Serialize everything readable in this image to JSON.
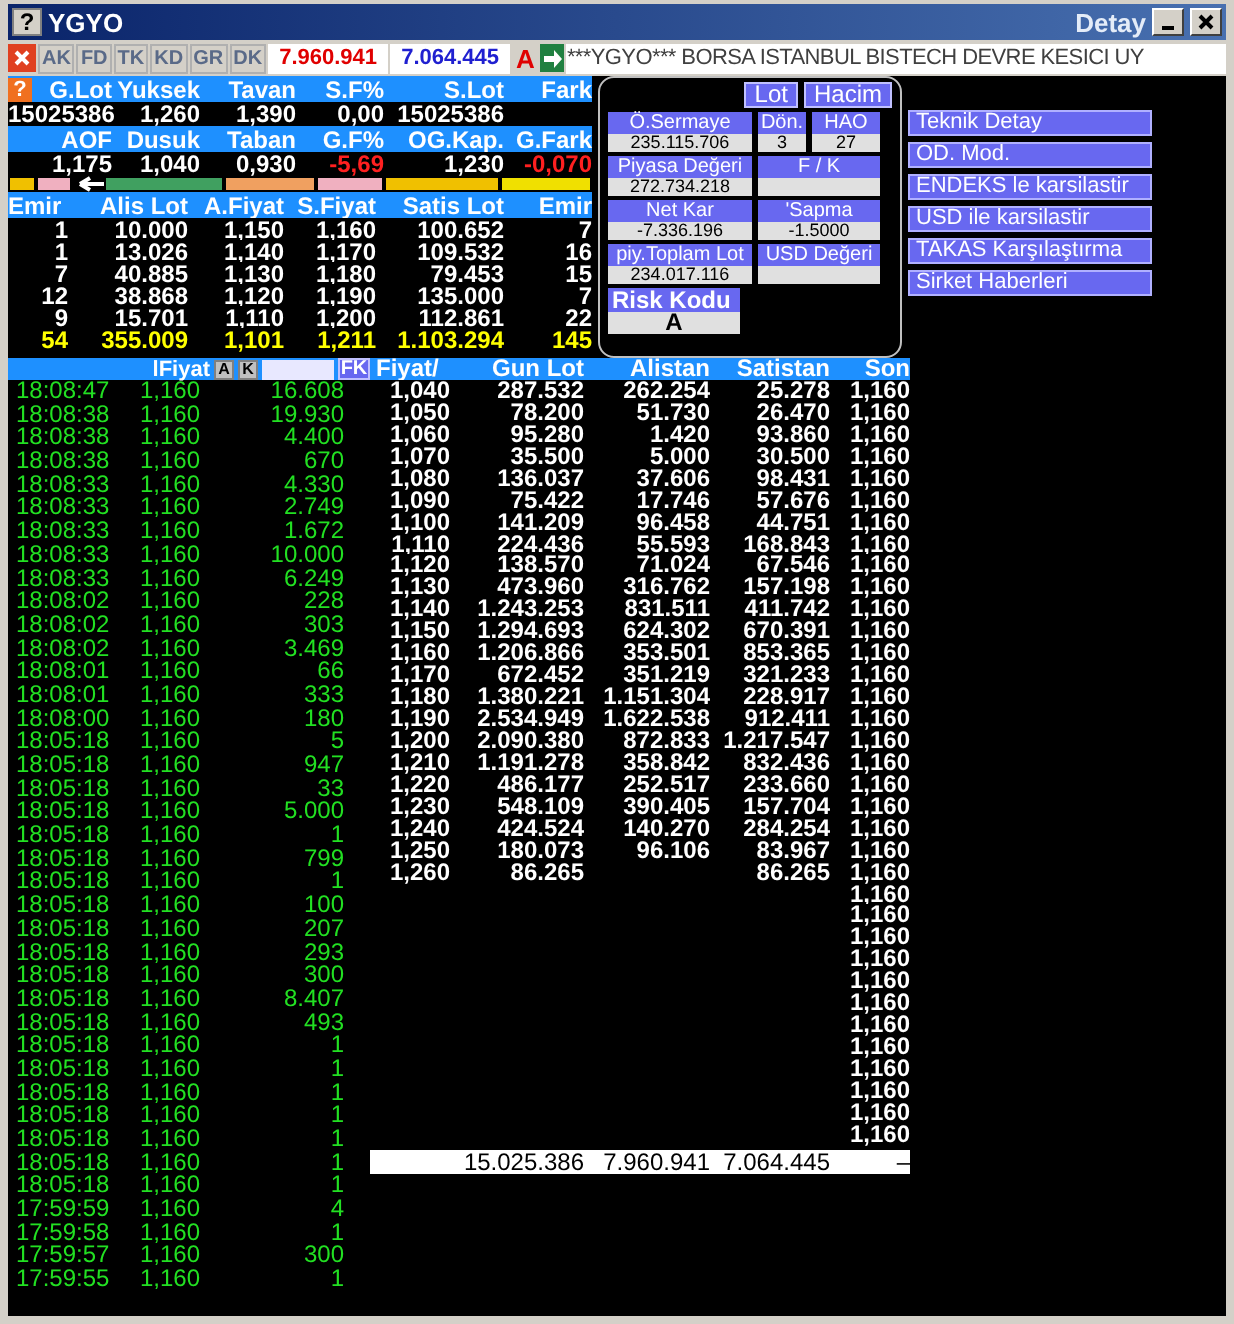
{
  "window": {
    "help": "?",
    "title": "YGYO",
    "detail_label": "Detay"
  },
  "toolbar": {
    "tabs": [
      "AK",
      "FD",
      "TK",
      "KD",
      "GR",
      "DK"
    ],
    "value_red": "7.960.941",
    "value_blue": "7.064.445",
    "letter": "A",
    "ticker": "***YGYO*** BORSA ISTANBUL BISTECH DEVRE KESICI UY"
  },
  "stats": {
    "help": "?",
    "rows": [
      {
        "headers": [
          "G.Lot",
          "Yuksek",
          "Tavan",
          "S.F%",
          "S.Lot",
          "Fark"
        ],
        "values": [
          {
            "text": "15025386",
            "negative": false
          },
          {
            "text": "1,260",
            "negative": false
          },
          {
            "text": "1,390",
            "negative": false
          },
          {
            "text": "0,00",
            "negative": false
          },
          {
            "text": "15025386",
            "negative": false
          }
        ]
      },
      {
        "headers": [
          "AOF",
          "Dusuk",
          "Taban",
          "G.F%",
          "OG.Kap.",
          "G.Fark"
        ],
        "values": [
          {
            "text": "1,175",
            "negative": false
          },
          {
            "text": "1,040",
            "negative": false
          },
          {
            "text": "0,930",
            "negative": false
          },
          {
            "text": "-5,69",
            "negative": true
          },
          {
            "text": "1,230",
            "negative": false
          },
          {
            "text": "-0,070",
            "negative": true
          }
        ]
      }
    ]
  },
  "order_book": {
    "columns": [
      "Emir",
      "Alis Lot",
      "A.Fiyat",
      "S.Fiyat",
      "Satis Lot",
      "Emir"
    ],
    "rows": [
      [
        "1",
        "10.000",
        "1,150",
        "1,160",
        "100.652",
        "7"
      ],
      [
        "1",
        "13.026",
        "1,140",
        "1,170",
        "109.532",
        "16"
      ],
      [
        "7",
        "40.885",
        "1,130",
        "1,180",
        "79.453",
        "15"
      ],
      [
        "12",
        "38.868",
        "1,120",
        "1,190",
        "135.000",
        "7"
      ],
      [
        "9",
        "15.701",
        "1,110",
        "1,200",
        "112.861",
        "22"
      ]
    ],
    "totals": [
      "54",
      "355.009",
      "1,101",
      "1,211",
      "1.103.294",
      "145"
    ]
  },
  "panel": {
    "toggles": [
      "Lot",
      "Hacim"
    ],
    "rows": [
      [
        {
          "label": "Ö.Sermaye",
          "value": "235.115.706"
        },
        {
          "label": "Dön.",
          "value": "3"
        },
        {
          "label": "HAO",
          "value": "27"
        }
      ],
      [
        {
          "label": "Piyasa Değeri",
          "value": "272.734.218"
        },
        {
          "label": "F / K"
        }
      ],
      [
        {
          "label": "Net Kar",
          "value": "-7.336.196"
        },
        {
          "label": "'Sapma",
          "value": "-1.5000"
        }
      ],
      [
        {
          "label": "piy.Toplam Lot",
          "value": "234.017.116"
        },
        {
          "label": "USD Değeri"
        }
      ]
    ],
    "risk": {
      "label": "Risk Kodu",
      "value": "A"
    }
  },
  "actions": [
    "Teknik Detay",
    "OD. Mod.",
    "ENDEKS le karsilastir",
    "USD ile karsilastir",
    "TAKAS Karşılaştırma",
    "Sirket Haberleri"
  ],
  "trades": {
    "header": "lFiyat",
    "buttons": [
      "A",
      "K"
    ],
    "filter_button": "FK",
    "rows": [
      [
        "18:08:47",
        "1,160",
        "16.608"
      ],
      [
        "18:08:38",
        "1,160",
        "19.930"
      ],
      [
        "18:08:38",
        "1,160",
        "4.400"
      ],
      [
        "18:08:38",
        "1,160",
        "670"
      ],
      [
        "18:08:33",
        "1,160",
        "4.330"
      ],
      [
        "18:08:33",
        "1,160",
        "2.749"
      ],
      [
        "18:08:33",
        "1,160",
        "1.672"
      ],
      [
        "18:08:33",
        "1,160",
        "10.000"
      ],
      [
        "18:08:33",
        "1,160",
        "6.249"
      ],
      [
        "18:08:02",
        "1,160",
        "228"
      ],
      [
        "18:08:02",
        "1,160",
        "303"
      ],
      [
        "18:08:02",
        "1,160",
        "3.469"
      ],
      [
        "18:08:01",
        "1,160",
        "66"
      ],
      [
        "18:08:01",
        "1,160",
        "333"
      ],
      [
        "18:08:00",
        "1,160",
        "180"
      ],
      [
        "18:05:18",
        "1,160",
        "5"
      ],
      [
        "18:05:18",
        "1,160",
        "947"
      ],
      [
        "18:05:18",
        "1,160",
        "33"
      ],
      [
        "18:05:18",
        "1,160",
        "5.000"
      ],
      [
        "18:05:18",
        "1,160",
        "1"
      ],
      [
        "18:05:18",
        "1,160",
        "799"
      ],
      [
        "18:05:18",
        "1,160",
        "1"
      ],
      [
        "18:05:18",
        "1,160",
        "100"
      ],
      [
        "18:05:18",
        "1,160",
        "207"
      ],
      [
        "18:05:18",
        "1,160",
        "293"
      ],
      [
        "18:05:18",
        "1,160",
        "300"
      ],
      [
        "18:05:18",
        "1,160",
        "8.407"
      ],
      [
        "18:05:18",
        "1,160",
        "493"
      ],
      [
        "18:05:18",
        "1,160",
        "1"
      ],
      [
        "18:05:18",
        "1,160",
        "1"
      ],
      [
        "18:05:18",
        "1,160",
        "1"
      ],
      [
        "18:05:18",
        "1,160",
        "1"
      ],
      [
        "18:05:18",
        "1,160",
        "1"
      ],
      [
        "18:05:18",
        "1,160",
        "1"
      ],
      [
        "18:05:18",
        "1,160",
        "1"
      ],
      [
        "17:59:59",
        "1,160",
        "4"
      ],
      [
        "17:59:58",
        "1,160",
        "1"
      ],
      [
        "17:59:57",
        "1,160",
        "300"
      ],
      [
        "17:59:55",
        "1,160",
        "1"
      ]
    ]
  },
  "price_table": {
    "columns": [
      "Fiyat/",
      "Gun Lot",
      "Alistan",
      "Satistan",
      "Son"
    ],
    "rows": [
      {
        "price": "1,040",
        "gun_lot": "287.532",
        "alistan": "262.254",
        "satistan": "25.278",
        "son": "1,160"
      },
      {
        "price": "1,050",
        "gun_lot": "78.200",
        "alistan": "51.730",
        "satistan": "26.470",
        "son": "1,160"
      },
      {
        "price": "1,060",
        "gun_lot": "95.280",
        "alistan": "1.420",
        "satistan": "93.860",
        "son": "1,160"
      },
      {
        "price": "1,070",
        "gun_lot": "35.500",
        "alistan": "5.000",
        "satistan": "30.500",
        "son": "1,160"
      },
      {
        "price": "1,080",
        "gun_lot": "136.037",
        "alistan": "37.606",
        "satistan": "98.431",
        "son": "1,160"
      },
      {
        "price": "1,090",
        "gun_lot": "75.422",
        "alistan": "17.746",
        "satistan": "57.676",
        "son": "1,160"
      },
      {
        "price": "1,100",
        "gun_lot": "141.209",
        "alistan": "96.458",
        "satistan": "44.751",
        "son": "1,160"
      },
      {
        "price": "1,110",
        "gun_lot": "224.436",
        "alistan": "55.593",
        "satistan": "168.843",
        "son": "1,160"
      },
      {
        "price": "1,120",
        "gun_lot": "138.570",
        "alistan": "71.024",
        "satistan": "67.546",
        "son": "1,160"
      },
      {
        "price": "1,130",
        "gun_lot": "473.960",
        "alistan": "316.762",
        "satistan": "157.198",
        "son": "1,160"
      },
      {
        "price": "1,140",
        "gun_lot": "1.243.253",
        "alistan": "831.511",
        "satistan": "411.742",
        "son": "1,160"
      },
      {
        "price": "1,150",
        "gun_lot": "1.294.693",
        "alistan": "624.302",
        "satistan": "670.391",
        "son": "1,160"
      },
      {
        "price": "1,160",
        "gun_lot": "1.206.866",
        "alistan": "353.501",
        "satistan": "853.365",
        "son": "1,160"
      },
      {
        "price": "1,170",
        "gun_lot": "672.452",
        "alistan": "351.219",
        "satistan": "321.233",
        "son": "1,160"
      },
      {
        "price": "1,180",
        "gun_lot": "1.380.221",
        "alistan": "1.151.304",
        "satistan": "228.917",
        "son": "1,160"
      },
      {
        "price": "1,190",
        "gun_lot": "2.534.949",
        "alistan": "1.622.538",
        "satistan": "912.411",
        "son": "1,160"
      },
      {
        "price": "1,200",
        "gun_lot": "2.090.380",
        "alistan": "872.833",
        "satistan": "1.217.547",
        "son": "1,160"
      },
      {
        "price": "1,210",
        "gun_lot": "1.191.278",
        "alistan": "358.842",
        "satistan": "832.436",
        "son": "1,160"
      },
      {
        "price": "1,220",
        "gun_lot": "486.177",
        "alistan": "252.517",
        "satistan": "233.660",
        "son": "1,160"
      },
      {
        "price": "1,230",
        "gun_lot": "548.109",
        "alistan": "390.405",
        "satistan": "157.704",
        "son": "1,160"
      },
      {
        "price": "1,240",
        "gun_lot": "424.524",
        "alistan": "140.270",
        "satistan": "284.254",
        "son": "1,160"
      },
      {
        "price": "1,250",
        "gun_lot": "180.073",
        "alistan": "96.106",
        "satistan": "83.967",
        "son": "1,160"
      },
      {
        "price": "1,260",
        "gun_lot": "86.265",
        "satistan": "86.265",
        "son": "1,160"
      },
      {
        "son": "1,160"
      },
      {
        "son": "1,160"
      },
      {
        "son": "1,160"
      },
      {
        "son": "1,160"
      },
      {
        "son": "1,160"
      },
      {
        "son": "1,160"
      },
      {
        "son": "1,160"
      },
      {
        "son": "1,160"
      },
      {
        "son": "1,160"
      },
      {
        "son": "1,160"
      },
      {
        "son": "1,160"
      },
      {
        "son": "1,160"
      }
    ],
    "totals": [
      "15.025.386",
      "7.960.941",
      "7.064.445",
      "–"
    ]
  }
}
